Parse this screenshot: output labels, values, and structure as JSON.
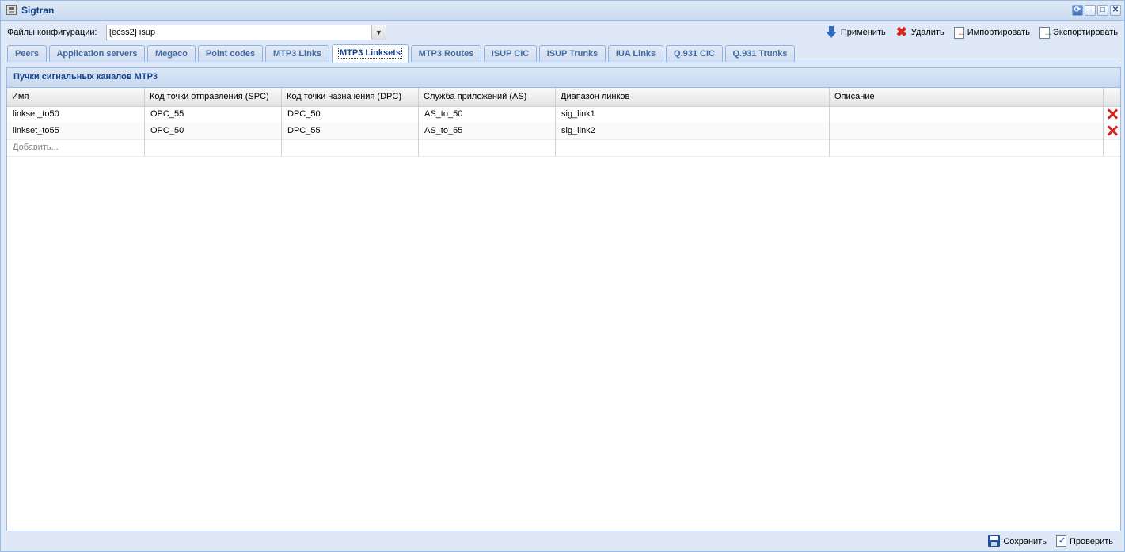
{
  "window": {
    "title": "Sigtran"
  },
  "config": {
    "label": "Файлы конфигурации:",
    "selected": "[ecss2] isup"
  },
  "actions": {
    "apply": "Применить",
    "delete": "Удалить",
    "import": "Импортировать",
    "export": "Экспортировать"
  },
  "tabs": [
    {
      "label": "Peers",
      "active": false
    },
    {
      "label": "Application servers",
      "active": false
    },
    {
      "label": "Megaco",
      "active": false
    },
    {
      "label": "Point codes",
      "active": false
    },
    {
      "label": "MTP3 Links",
      "active": false
    },
    {
      "label": "MTP3 Linksets",
      "active": true
    },
    {
      "label": "MTP3 Routes",
      "active": false
    },
    {
      "label": "ISUP CIC",
      "active": false
    },
    {
      "label": "ISUP Trunks",
      "active": false
    },
    {
      "label": "IUA Links",
      "active": false
    },
    {
      "label": "Q.931 CIC",
      "active": false
    },
    {
      "label": "Q.931 Trunks",
      "active": false
    }
  ],
  "panel": {
    "title": "Пучки сигнальных каналов MTP3"
  },
  "grid": {
    "columns": [
      "Имя",
      "Код точки отправления (SPC)",
      "Код точки назначения (DPC)",
      "Служба приложений (AS)",
      "Диапазон линков",
      "Описание"
    ],
    "rows": [
      [
        "linkset_to50",
        "OPC_55",
        "DPC_50",
        "AS_to_50",
        "sig_link1",
        ""
      ],
      [
        "linkset_to55",
        "OPC_50",
        "DPC_55",
        "AS_to_55",
        "sig_link2",
        ""
      ]
    ],
    "add_placeholder": "Добавить..."
  },
  "footer": {
    "save": "Сохранить",
    "check": "Проверить"
  },
  "icons": {
    "apply": "arrow-down-icon",
    "delete": "red-x-icon",
    "import": "import-icon",
    "export": "export-icon",
    "save": "floppy-icon",
    "check": "check-doc-icon",
    "row_delete": "red-x-icon"
  },
  "colors": {
    "title": "#15428b",
    "border": "#99bbe8",
    "delete": "#d7261e"
  }
}
